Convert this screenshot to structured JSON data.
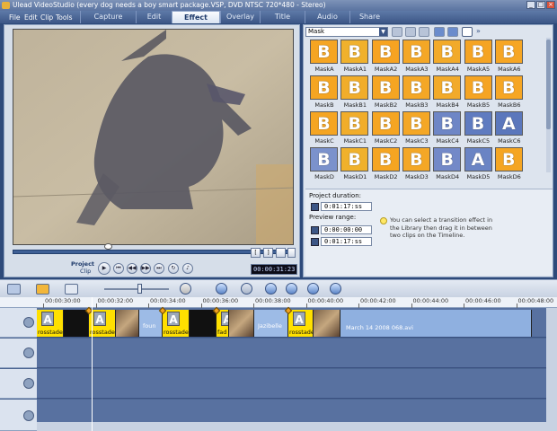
{
  "window": {
    "title": "Ulead VideoStudio (every dog needs a boy smart package.VSP, DVD NTSC 720*480 - Stereo)",
    "minimize_label": "_",
    "maximize_label": "□",
    "close_label": "×"
  },
  "menu": {
    "items": [
      "File",
      "Edit",
      "Clip",
      "Tools"
    ]
  },
  "steps": {
    "tabs": [
      "Capture",
      "Edit",
      "Effect",
      "Overlay",
      "Title",
      "Audio",
      "Share"
    ],
    "active": "Effect"
  },
  "preview": {
    "mode_label_top": "Project",
    "mode_label_bottom": "Clip",
    "timecode": "00:00:31:23",
    "controls": {
      "play": "▶",
      "home": "⏮",
      "prev": "◀◀",
      "next": "▶▶",
      "end": "⏭",
      "repeat": "↻",
      "volume": "♪",
      "mark_in": "[",
      "mark_out": "]"
    }
  },
  "library": {
    "category": "Mask",
    "category_arrow": "▼",
    "masks": [
      {
        "label": "MaskA",
        "glyph": "B",
        "bg": "#f5a522"
      },
      {
        "label": "MaskA1",
        "glyph": "B",
        "bg": "#f0b12c"
      },
      {
        "label": "MaskA2",
        "glyph": "B",
        "bg": "#f7a321"
      },
      {
        "label": "MaskA3",
        "glyph": "B",
        "bg": "#f4a726"
      },
      {
        "label": "MaskA4",
        "glyph": "B",
        "bg": "#f2aa2a"
      },
      {
        "label": "MaskA5",
        "glyph": "B",
        "bg": "#f5a423"
      },
      {
        "label": "MaskA6",
        "glyph": "B",
        "bg": "#f6a624"
      },
      {
        "label": "MaskB",
        "glyph": "B",
        "bg": "#f5a522"
      },
      {
        "label": "MaskB1",
        "glyph": "B",
        "bg": "#f1ad2a"
      },
      {
        "label": "MaskB2",
        "glyph": "B",
        "bg": "#f5a522"
      },
      {
        "label": "MaskB3",
        "glyph": "B",
        "bg": "#f4a726"
      },
      {
        "label": "MaskB4",
        "glyph": "B",
        "bg": "#f2aa2a"
      },
      {
        "label": "MaskB5",
        "glyph": "B",
        "bg": "#f5a423"
      },
      {
        "label": "MaskB6",
        "glyph": "B",
        "bg": "#f6a624"
      },
      {
        "label": "MaskC",
        "glyph": "B",
        "bg": "#f5a522"
      },
      {
        "label": "MaskC1",
        "glyph": "B",
        "bg": "#f1ad2a"
      },
      {
        "label": "MaskC2",
        "glyph": "B",
        "bg": "#f5a522"
      },
      {
        "label": "MaskC3",
        "glyph": "B",
        "bg": "#f4a726"
      },
      {
        "label": "MaskC4",
        "glyph": "B",
        "bg": "#6e86c6"
      },
      {
        "label": "MaskC5",
        "glyph": "B",
        "bg": "#5f7bc0"
      },
      {
        "label": "MaskC6",
        "glyph": "A",
        "bg": "#5b77bc"
      },
      {
        "label": "MaskD",
        "glyph": "B",
        "bg": "#7b92cc"
      },
      {
        "label": "MaskD1",
        "glyph": "B",
        "bg": "#f0b12c"
      },
      {
        "label": "MaskD2",
        "glyph": "B",
        "bg": "#f5a522"
      },
      {
        "label": "MaskD3",
        "glyph": "B",
        "bg": "#f4a726"
      },
      {
        "label": "MaskD4",
        "glyph": "B",
        "bg": "#7389c8"
      },
      {
        "label": "MaskD5",
        "glyph": "A",
        "bg": "#6a84c4"
      },
      {
        "label": "MaskD6",
        "glyph": "B",
        "bg": "#f5a522"
      }
    ]
  },
  "options": {
    "project_duration_label": "Project duration:",
    "project_duration": "0:01:17:ss",
    "preview_range_label": "Preview range:",
    "range_start": "0:00:00:00",
    "range_end": "0:01:17:ss",
    "hint": "You can select a transition effect in the Library then drag it in between two clips on the Timeline."
  },
  "timeline": {
    "ruler_labels": [
      "00:00:30:00",
      "00:00:32:00",
      "00:00:34:00",
      "00:00:36:00",
      "00:00:38:00",
      "00:00:40:00",
      "00:00:42:00",
      "00:00:44:00",
      "00:00:46:00",
      "00:00:48:00"
    ],
    "clips": [
      {
        "type": "title",
        "label": "rosstade-F"
      },
      {
        "type": "dark",
        "label": ""
      },
      {
        "type": "title",
        "label": "rosstade-F"
      },
      {
        "type": "photo",
        "label": ""
      },
      {
        "type": "blue",
        "label": "foun"
      },
      {
        "type": "title",
        "label": "rosstade-F"
      },
      {
        "type": "dark",
        "label": ""
      },
      {
        "type": "title",
        "label": "fad"
      },
      {
        "type": "photo",
        "label": ""
      },
      {
        "type": "blue",
        "label": "Jazibelle"
      },
      {
        "type": "title",
        "label": "rosstade-F"
      },
      {
        "type": "photo",
        "label": ""
      },
      {
        "type": "video-clip",
        "label": "March 14 2008 068.avi"
      }
    ]
  },
  "colors": {
    "accent": "#3c5686",
    "title_clip": "#ffe000",
    "video_clip": "#8fb0e0"
  }
}
